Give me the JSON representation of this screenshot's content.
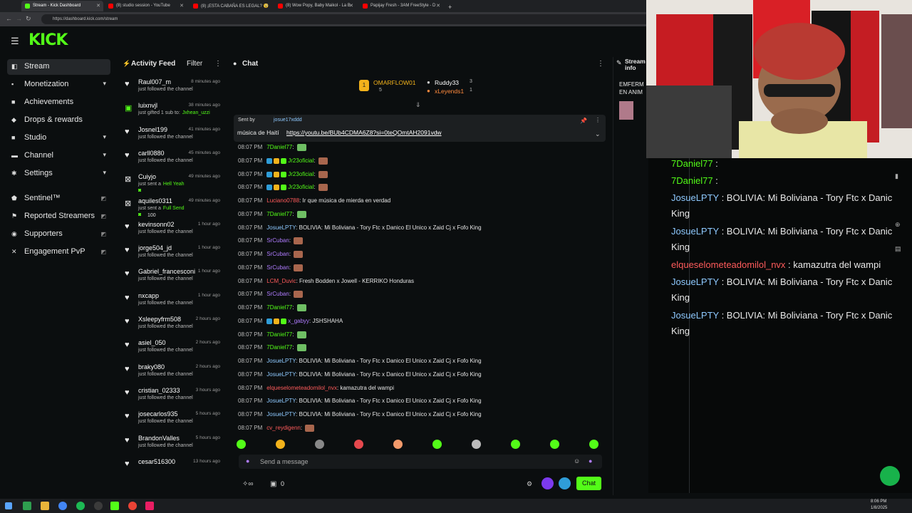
{
  "browser": {
    "tabs": [
      {
        "title": "Stream - Kick Dashboard",
        "color": "#53fc18"
      },
      {
        "title": "(8) studio session - YouTube",
        "color": "#ff0000"
      },
      {
        "title": "(8) ¡ESTA CABAÑA ES LEGAL? 😯",
        "color": "#ff0000"
      },
      {
        "title": "(8) Wow Popy, Baby Maikol - La B",
        "color": "#ff0000"
      },
      {
        "title": "Papijay Fresh - 3AM FreeStyle - D",
        "color": "#ff0000"
      }
    ],
    "url": "https://dashboard.kick.com/stream"
  },
  "header": {
    "logo": "KICK"
  },
  "sidebar": {
    "items": [
      {
        "label": "Stream",
        "icon": "stream-icon"
      },
      {
        "label": "Monetization",
        "icon": "monetization-icon"
      },
      {
        "label": "Achievements",
        "icon": "achievements-icon"
      },
      {
        "label": "Drops & rewards",
        "icon": "drops-icon"
      },
      {
        "label": "Studio",
        "icon": "studio-icon"
      },
      {
        "label": "Channel",
        "icon": "channel-icon"
      },
      {
        "label": "Settings",
        "icon": "settings-icon"
      },
      {
        "label": "Sentinel™",
        "icon": "sentinel-icon"
      },
      {
        "label": "Reported Streamers",
        "icon": "flag-icon"
      },
      {
        "label": "Supporters",
        "icon": "supporters-icon"
      },
      {
        "label": "Engagement PvP",
        "icon": "pvp-icon"
      }
    ]
  },
  "activity": {
    "title": "Activity Feed",
    "filter": "Filter",
    "items": [
      {
        "name": "Raul007_m",
        "time": "8 minutes ago",
        "desc": "just followed the channel"
      },
      {
        "name": "luixnvjl",
        "time": "38 minutes ago",
        "desc": "just gifted 1 sub to:",
        "extra": "Jxhean_uzzi"
      },
      {
        "name": "Josnel199",
        "time": "41 minutes ago",
        "desc": "just followed the channel"
      },
      {
        "name": "carll0880",
        "time": "45 minutes ago",
        "desc": "just followed the channel"
      },
      {
        "name": "Cuiyjo",
        "time": "49 minutes ago",
        "desc": "just sent a",
        "extra": "Hell Yeah"
      },
      {
        "name": "aquiles0311",
        "time": "49 minutes ago",
        "desc": "just sent a",
        "extra": "Full Send",
        "amount": "100"
      },
      {
        "name": "kevinsonn02",
        "time": "1 hour ago",
        "desc": "just followed the channel"
      },
      {
        "name": "jorge504_jd",
        "time": "1 hour ago",
        "desc": "just followed the channel"
      },
      {
        "name": "Gabriel_francesconi",
        "time": "1 hour ago",
        "desc": "just followed the channel"
      },
      {
        "name": "nxcapp",
        "time": "1 hour ago",
        "desc": "just followed the channel"
      },
      {
        "name": "Xsleepyfrm508",
        "time": "2 hours ago",
        "desc": "just followed the channel"
      },
      {
        "name": "asiel_050",
        "time": "2 hours ago",
        "desc": "just followed the channel"
      },
      {
        "name": "braky080",
        "time": "2 hours ago",
        "desc": "just followed the channel"
      },
      {
        "name": "cristian_02333",
        "time": "3 hours ago",
        "desc": "just followed the channel"
      },
      {
        "name": "josecarlos935",
        "time": "5 hours ago",
        "desc": "just followed the channel"
      },
      {
        "name": "BrandonValles",
        "time": "5 hours ago",
        "desc": "just followed the channel"
      },
      {
        "name": "cesar516300",
        "time": "13 hours ago",
        "desc": ""
      }
    ]
  },
  "chat": {
    "title": "Chat",
    "leaders": [
      {
        "name": "OMARFLOW01",
        "count": "5"
      },
      {
        "name": "Ruddy33",
        "count": "3"
      },
      {
        "name": "xLeyends1",
        "count": "1"
      }
    ],
    "pinned": {
      "sent_by": "Sent by",
      "user": "josue17xddd",
      "text": "música de Haití",
      "link": "https://youtu.be/BUb4CDMA6Z8?si=0teQOmtAH2091vdw"
    },
    "messages": [
      {
        "time": "08:07 PM",
        "user": "7Daniel77",
        "text": ":",
        "color": "u-green",
        "emote": "g"
      },
      {
        "time": "08:07 PM",
        "user": "Jr23oficial",
        "text": ":",
        "color": "u-green",
        "emote": "r"
      },
      {
        "time": "08:07 PM",
        "user": "Jr23oficial",
        "text": ":",
        "color": "u-green",
        "emote": "r"
      },
      {
        "time": "08:07 PM",
        "user": "Jr23oficial",
        "text": ":",
        "color": "u-green",
        "emote": "r"
      },
      {
        "time": "08:07 PM",
        "user": "Luciano0788",
        "text": ": Ir que música de mierda en verdad",
        "color": "u-red"
      },
      {
        "time": "08:07 PM",
        "user": "7Daniel77",
        "text": ":",
        "color": "u-green",
        "emote": "g"
      },
      {
        "time": "08:07 PM",
        "user": "JosueLPTY",
        "text": ": BOLIVIA: Mi Boliviana - Tory Ftc x Danico El Unico x Zaid Cj x Fofo King",
        "color": "u-blue"
      },
      {
        "time": "08:07 PM",
        "user": "SrCuban",
        "text": ":",
        "color": "u-purple",
        "emote": "r"
      },
      {
        "time": "08:07 PM",
        "user": "SrCuban",
        "text": ":",
        "color": "u-purple",
        "emote": "r"
      },
      {
        "time": "08:07 PM",
        "user": "SrCuban",
        "text": ":",
        "color": "u-purple",
        "emote": "r"
      },
      {
        "time": "08:07 PM",
        "user": "LCM_Duvic",
        "text": ": Fresh Bodden x Jowell - KERRIKO Honduras",
        "color": "u-red"
      },
      {
        "time": "08:07 PM",
        "user": "SrCuban",
        "text": ":",
        "color": "u-purple",
        "emote": "r"
      },
      {
        "time": "08:07 PM",
        "user": "7Daniel77",
        "text": ":",
        "color": "u-green",
        "emote": "g"
      },
      {
        "time": "08:07 PM",
        "user": "x_gabyy",
        "text": ": JSHSHAHA",
        "color": "u-purple"
      },
      {
        "time": "08:07 PM",
        "user": "7Daniel77",
        "text": ":",
        "color": "u-green",
        "emote": "g"
      },
      {
        "time": "08:07 PM",
        "user": "7Daniel77",
        "text": ":",
        "color": "u-green",
        "emote": "g"
      },
      {
        "time": "08:07 PM",
        "user": "JosueLPTY",
        "text": ": BOLIVIA: Mi Boliviana - Tory Ftc x Danico El Unico x Zaid Cj x Fofo King",
        "color": "u-blue"
      },
      {
        "time": "08:07 PM",
        "user": "JosueLPTY",
        "text": ": BOLIVIA: Mi Boliviana - Tory Ftc x Danico El Unico x Zaid Cj x Fofo King",
        "color": "u-blue"
      },
      {
        "time": "08:07 PM",
        "user": "elqueselometeadomilol_nvx",
        "text": ": kamazutra del wampi",
        "color": "u-red"
      },
      {
        "time": "08:07 PM",
        "user": "JosueLPTY",
        "text": ": BOLIVIA: Mi Boliviana - Tory Ftc x Danico El Unico x Zaid Cj x Fofo King",
        "color": "u-blue"
      },
      {
        "time": "08:07 PM",
        "user": "JosueLPTY",
        "text": ": BOLIVIA: Mi Boliviana - Tory Ftc x Danico El Unico x Zaid Cj x Fofo King",
        "color": "u-blue"
      },
      {
        "time": "08:07 PM",
        "user": "cv_reydigenn",
        "text": ":",
        "color": "u-red",
        "emote": "r"
      }
    ],
    "input_placeholder": "Send a message",
    "count": "0",
    "send_label": "Chat"
  },
  "stream_info": {
    "title": "Stream info",
    "line1": "EMFERM",
    "line2": "EN ANIM"
  },
  "overlay": {
    "lines": [
      {
        "user": "7Daniel77",
        "text": " : ",
        "color": "#53fc18"
      },
      {
        "user": "7Daniel77",
        "text": " : ",
        "color": "#53fc18"
      },
      {
        "user": "JosueLPTY",
        "text": " : BOLIVIA: Mi Boliviana - Tory Ftc x Danic",
        "wrap": "King",
        "color": "#8ec9ff"
      },
      {
        "user": "JosueLPTY",
        "text": " : BOLIVIA: Mi Boliviana - Tory Ftc x Danic",
        "wrap": "King",
        "color": "#8ec9ff"
      },
      {
        "user": "elqueselometeadomilol_nvx",
        "text": " : kamazutra del wampi",
        "color": "#ff5b5b"
      },
      {
        "user": "JosueLPTY",
        "text": " : BOLIVIA: Mi Boliviana - Tory Ftc x Danic",
        "wrap": "King",
        "color": "#8ec9ff"
      },
      {
        "user": "JosueLPTY",
        "text": " : BOLIVIA: Mi Boliviana - Tory Ftc x Danic",
        "wrap": "King",
        "color": "#8ec9ff"
      }
    ]
  },
  "taskbar": {
    "time": "8:06 PM",
    "date": "1/8/2025"
  },
  "colors": {
    "accent": "#53fc18",
    "bg": "#0b0e0f"
  }
}
